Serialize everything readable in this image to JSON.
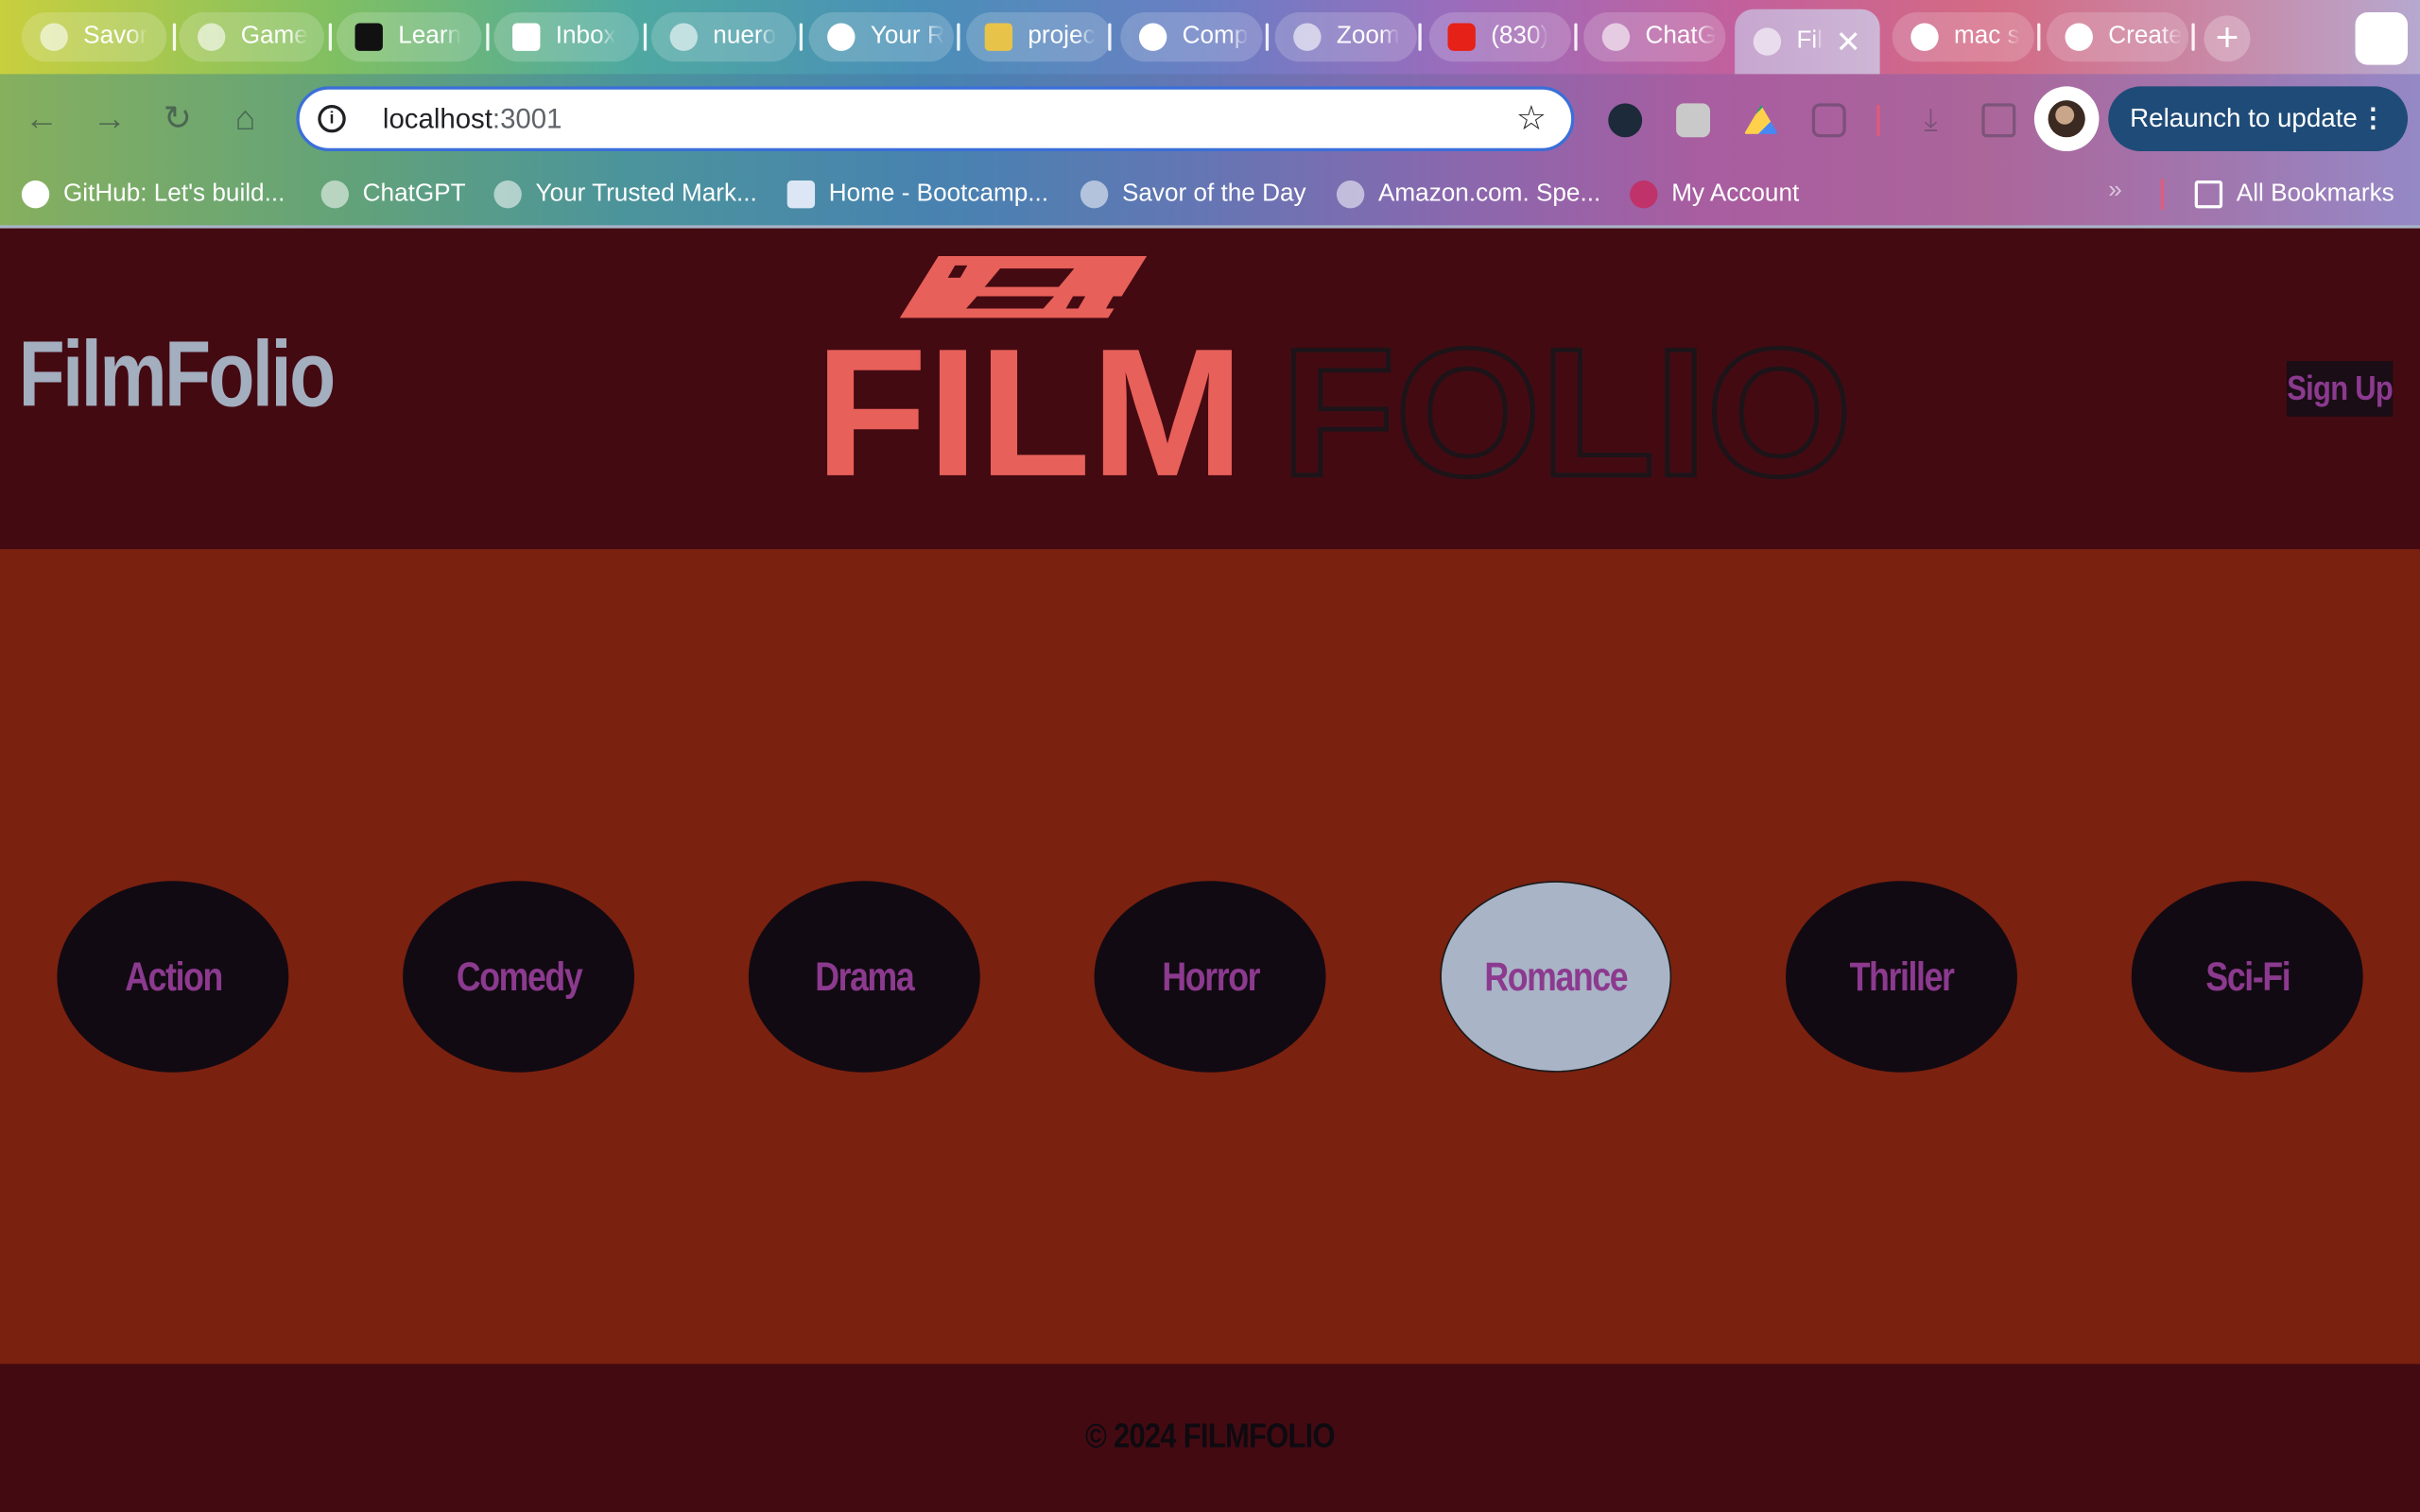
{
  "browser": {
    "tabs": [
      {
        "label": "Savor"
      },
      {
        "label": "Game"
      },
      {
        "label": "Learn"
      },
      {
        "label": "Inbox"
      },
      {
        "label": "nuero"
      },
      {
        "label": "Your R"
      },
      {
        "label": "projec"
      },
      {
        "label": "Comp"
      },
      {
        "label": "Zoom"
      },
      {
        "label": "(830)"
      },
      {
        "label": "ChatG"
      },
      {
        "label": "Fil"
      },
      {
        "label": "mac s"
      },
      {
        "label": "Create"
      }
    ],
    "address": {
      "host": "localhost",
      "port": ":3001"
    },
    "relaunch_label": "Relaunch to update",
    "bookmarks": [
      {
        "label": "GitHub: Let's build..."
      },
      {
        "label": "ChatGPT"
      },
      {
        "label": "Your Trusted Mark..."
      },
      {
        "label": "Home - Bootcamp..."
      },
      {
        "label": "Savor of the Day"
      },
      {
        "label": "Amazon.com. Spe..."
      },
      {
        "label": "My Account"
      }
    ],
    "all_bookmarks_label": "All Bookmarks"
  },
  "header": {
    "brand": "FilmFolio",
    "logo_word_1": "FILM",
    "logo_word_2": "FOLIO",
    "signup_label": "Sign Up"
  },
  "genres": [
    {
      "label": "Action",
      "active": false
    },
    {
      "label": "Comedy",
      "active": false
    },
    {
      "label": "Drama",
      "active": false
    },
    {
      "label": "Horror",
      "active": false
    },
    {
      "label": "Romance",
      "active": true
    },
    {
      "label": "Thriller",
      "active": false
    },
    {
      "label": "Sci-Fi",
      "active": false
    }
  ],
  "footer": {
    "copyright": "© 2024 FILMFOLIO"
  },
  "colors": {
    "header_bg": "#440a12",
    "main_bg": "#7b2110",
    "logo_red": "#e8605a",
    "genre_text": "#8c3a8f",
    "brand_gray": "#a3aebf"
  }
}
